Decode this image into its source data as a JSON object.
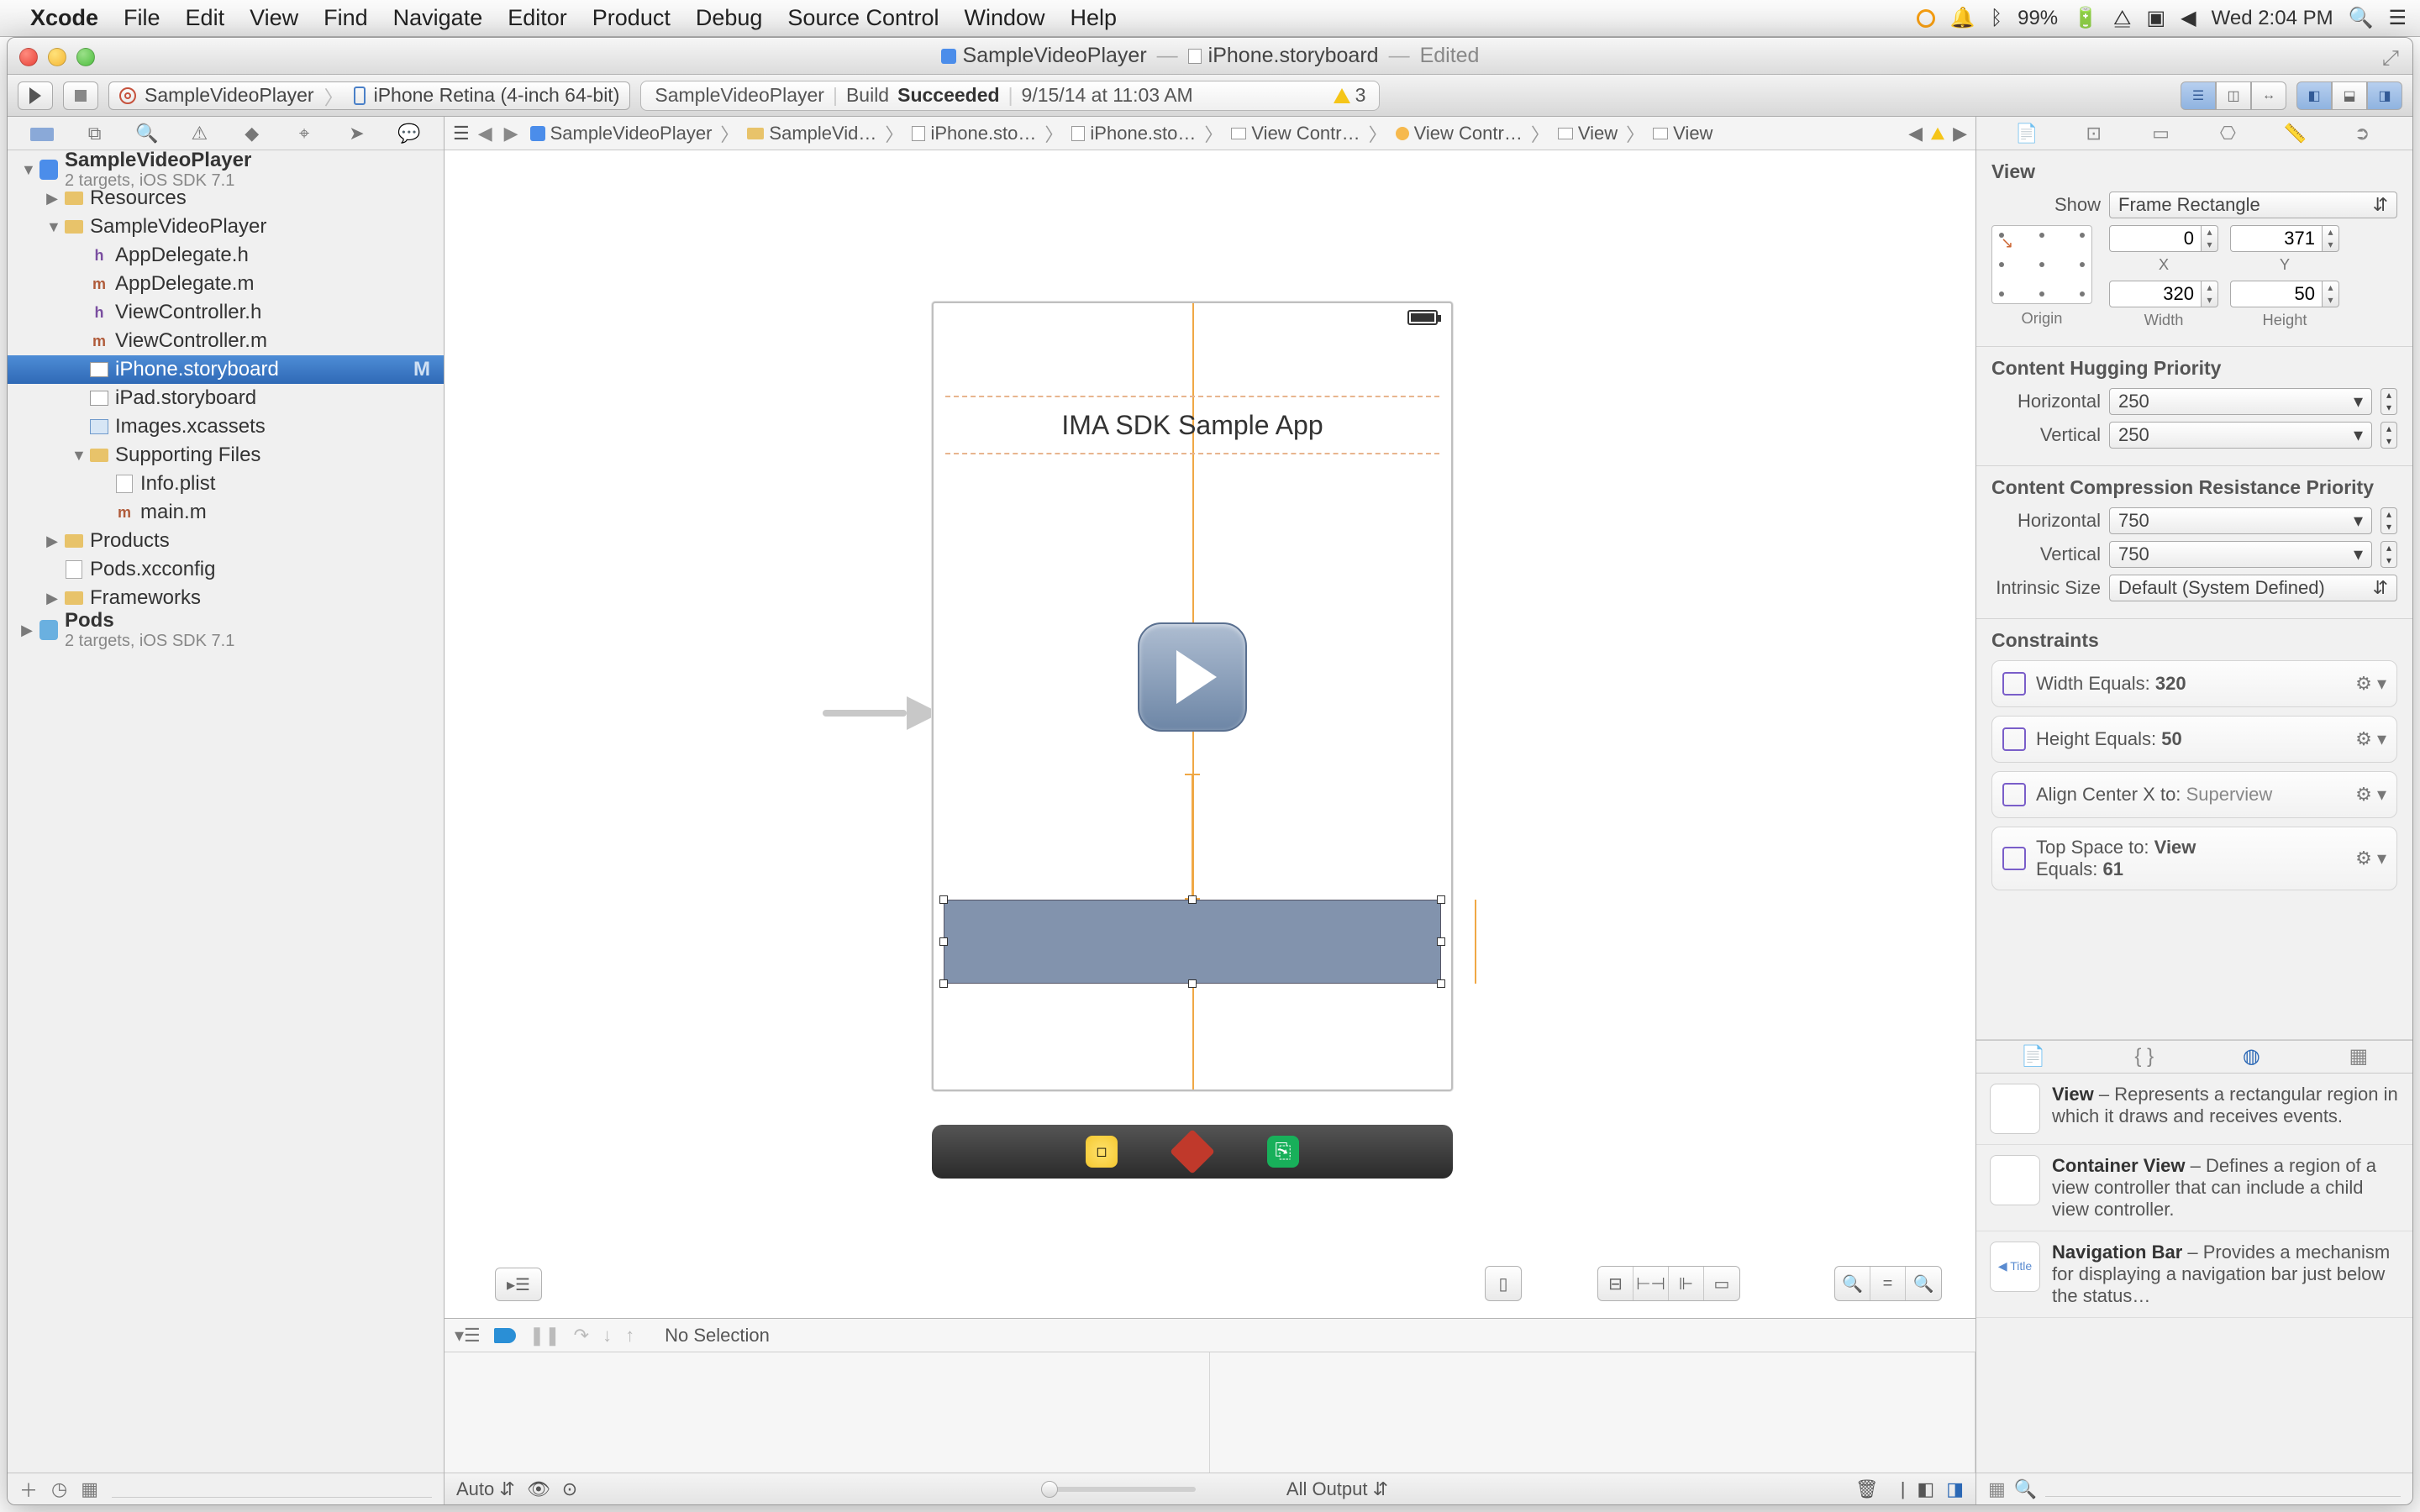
{
  "menubar": {
    "app": "Xcode",
    "items": [
      "File",
      "Edit",
      "View",
      "Find",
      "Navigate",
      "Editor",
      "Product",
      "Debug",
      "Source Control",
      "Window",
      "Help"
    ],
    "battery_pct": "99%",
    "clock": "Wed 2:04 PM"
  },
  "window": {
    "title_left": "SampleVideoPlayer",
    "title_right": "iPhone.storyboard",
    "title_state": "Edited"
  },
  "toolbar": {
    "scheme_target": "SampleVideoPlayer",
    "scheme_device": "iPhone Retina (4-inch 64-bit)",
    "status_project": "SampleVideoPlayer",
    "status_prefix": "Build",
    "status_result": "Succeeded",
    "status_time": "9/15/14 at 11:03 AM",
    "warn_count": "3"
  },
  "navigator": {
    "project": "SampleVideoPlayer",
    "project_sub": "2 targets, iOS SDK 7.1",
    "tree": [
      {
        "ind": 1,
        "disc": "▶",
        "icon": "folder",
        "label": "Resources"
      },
      {
        "ind": 1,
        "disc": "▼",
        "icon": "folder",
        "label": "SampleVideoPlayer"
      },
      {
        "ind": 2,
        "disc": "",
        "icon": "h",
        "label": "AppDelegate.h"
      },
      {
        "ind": 2,
        "disc": "",
        "icon": "m",
        "label": "AppDelegate.m"
      },
      {
        "ind": 2,
        "disc": "",
        "icon": "h",
        "label": "ViewController.h"
      },
      {
        "ind": 2,
        "disc": "",
        "icon": "m",
        "label": "ViewController.m"
      },
      {
        "ind": 2,
        "disc": "",
        "icon": "sb",
        "label": "iPhone.storyboard",
        "sel": true,
        "mod": "M"
      },
      {
        "ind": 2,
        "disc": "",
        "icon": "sb",
        "label": "iPad.storyboard"
      },
      {
        "ind": 2,
        "disc": "",
        "icon": "xc",
        "label": "Images.xcassets"
      },
      {
        "ind": 2,
        "disc": "▼",
        "icon": "folder",
        "label": "Supporting Files"
      },
      {
        "ind": 3,
        "disc": "",
        "icon": "txt",
        "label": "Info.plist"
      },
      {
        "ind": 3,
        "disc": "",
        "icon": "m",
        "label": "main.m"
      },
      {
        "ind": 1,
        "disc": "▶",
        "icon": "folder",
        "label": "Products"
      },
      {
        "ind": 1,
        "disc": "",
        "icon": "txt",
        "label": "Pods.xcconfig"
      },
      {
        "ind": 1,
        "disc": "▶",
        "icon": "folder",
        "label": "Frameworks"
      }
    ],
    "pods_label": "Pods",
    "pods_sub": "2 targets, iOS SDK 7.1"
  },
  "jumpbar": {
    "items": [
      "SampleVideoPlayer",
      "SampleVid…",
      "iPhone.sto…",
      "iPhone.sto…",
      "View Contr…",
      "View Contr…",
      "View",
      "View"
    ]
  },
  "canvas": {
    "label_text": "IMA SDK Sample App"
  },
  "debug": {
    "no_selection": "No Selection",
    "auto": "Auto",
    "all_output": "All Output"
  },
  "inspector": {
    "header": "View",
    "show_label": "Show",
    "show_value": "Frame Rectangle",
    "x": "0",
    "y": "371",
    "w": "320",
    "h": "50",
    "x_label": "X",
    "y_label": "Y",
    "w_label": "Width",
    "h_label": "Height",
    "origin_label": "Origin",
    "hug_h": "Content Hugging Priority",
    "hug_hor": "250",
    "hug_ver": "250",
    "crp_h": "Content Compression Resistance Priority",
    "crp_hor": "750",
    "crp_ver": "750",
    "intrinsic_label": "Intrinsic Size",
    "intrinsic_value": "Default (System Defined)",
    "constraints_h": "Constraints",
    "c1": "Width Equals:",
    "c1v": "320",
    "c2": "Height Equals:",
    "c2v": "50",
    "c3": "Align Center X to:",
    "c3v": "Superview",
    "c4a": "Top Space to:",
    "c4av": "View",
    "c4b": "Equals:",
    "c4bv": "61",
    "hor_label": "Horizontal",
    "ver_label": "Vertical"
  },
  "library": {
    "items": [
      {
        "title": "View",
        "desc": " – Represents a rectangular region in which it draws and receives events."
      },
      {
        "title": "Container View",
        "desc": " – Defines a region of a view controller that can include a child view controller."
      },
      {
        "title": "Navigation Bar",
        "desc": " – Provides a mechanism for displaying a navigation bar just below the status…",
        "back": true
      }
    ]
  }
}
